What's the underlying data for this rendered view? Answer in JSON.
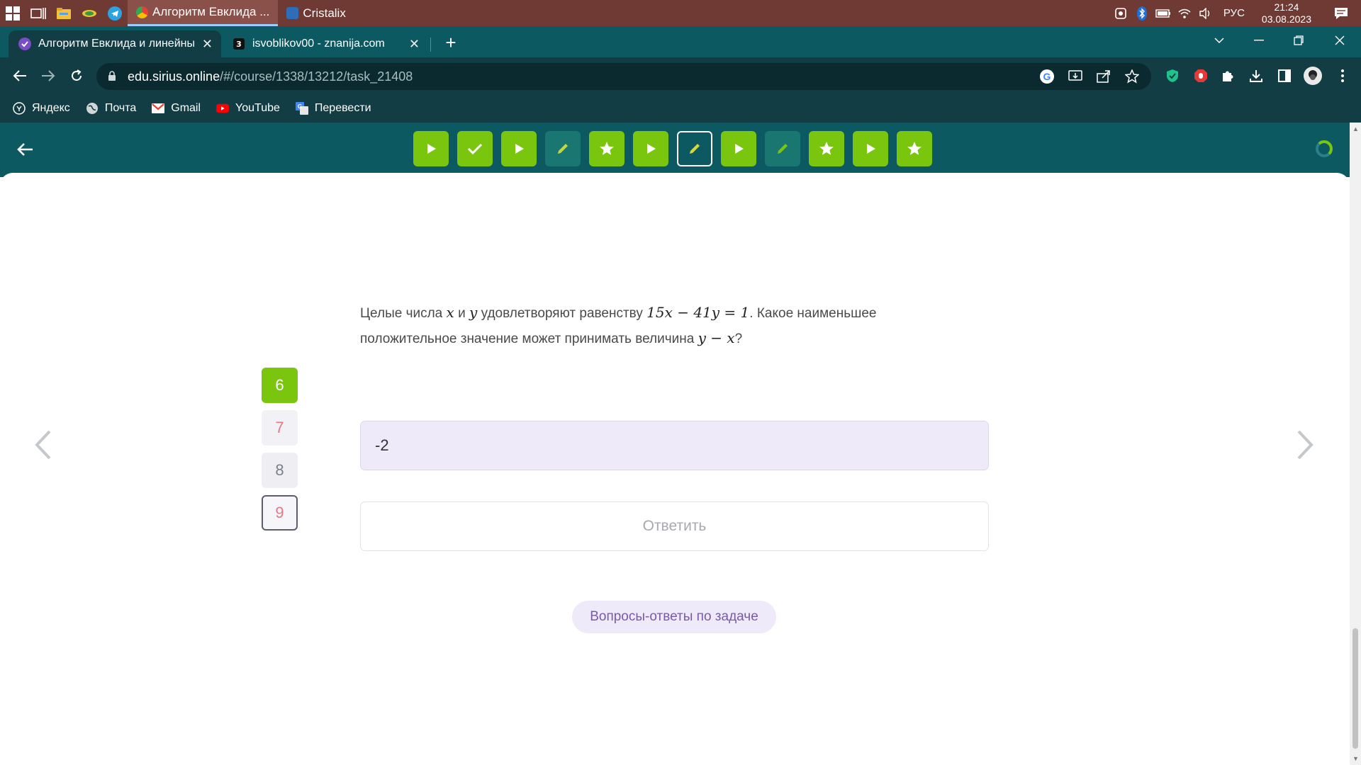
{
  "taskbar": {
    "tasks": [
      {
        "label": "Алгоритм Евклида ...",
        "active": true
      },
      {
        "label": "Cristalix",
        "active": false
      }
    ],
    "language": "РУС",
    "time": "21:24",
    "date": "03.08.2023"
  },
  "browser": {
    "tabs": [
      {
        "title": "Алгоритм Евклида и линейные",
        "active": true
      },
      {
        "title": "isvoblikov00 - znanija.com",
        "active": false
      }
    ],
    "url_host": "edu.sirius.online",
    "url_path": "/#/course/1338/13212/task_21408",
    "bookmarks": [
      {
        "label": "Яндекс",
        "icon": "yandex-icon"
      },
      {
        "label": "Почта",
        "icon": "globe-icon"
      },
      {
        "label": "Gmail",
        "icon": "gmail-icon"
      },
      {
        "label": "YouTube",
        "icon": "youtube-icon"
      },
      {
        "label": "Перевести",
        "icon": "translate-icon"
      }
    ]
  },
  "course_nav": {
    "tasks": [
      {
        "icon": "play-icon",
        "state": "green"
      },
      {
        "icon": "check-icon",
        "state": "green"
      },
      {
        "icon": "play-icon",
        "state": "green"
      },
      {
        "icon": "pencil-icon",
        "state": "teal"
      },
      {
        "icon": "star-icon",
        "state": "green"
      },
      {
        "icon": "play-icon",
        "state": "green"
      },
      {
        "icon": "pencil-icon",
        "state": "current"
      },
      {
        "icon": "play-icon",
        "state": "green"
      },
      {
        "icon": "pencil-icon",
        "state": "teal"
      },
      {
        "icon": "star-icon",
        "state": "green"
      },
      {
        "icon": "play-icon",
        "state": "green"
      },
      {
        "icon": "star-icon",
        "state": "green"
      }
    ]
  },
  "question": {
    "text_1": "Целые числа ",
    "var_x": "x",
    "text_2": " и ",
    "var_y": "y",
    "text_3": " удовлетворяют равенству ",
    "equation": "15x − 41y = 1",
    "text_4": ". Какое наименьшее положительное значение может принимать величина ",
    "expression": "y − x",
    "text_5": "?"
  },
  "subtasks": [
    {
      "label": "6",
      "state": "done"
    },
    {
      "label": "7",
      "state": "wrong"
    },
    {
      "label": "8",
      "state": "pending"
    },
    {
      "label": "9",
      "state": "selected"
    }
  ],
  "answer": {
    "value": "-2",
    "submit_label": "Ответить"
  },
  "qa_label": "Вопросы-ответы по задаче",
  "colors": {
    "header": "#0c5962",
    "accent_green": "#7ac60f",
    "answer_bg": "#eeeafa"
  }
}
